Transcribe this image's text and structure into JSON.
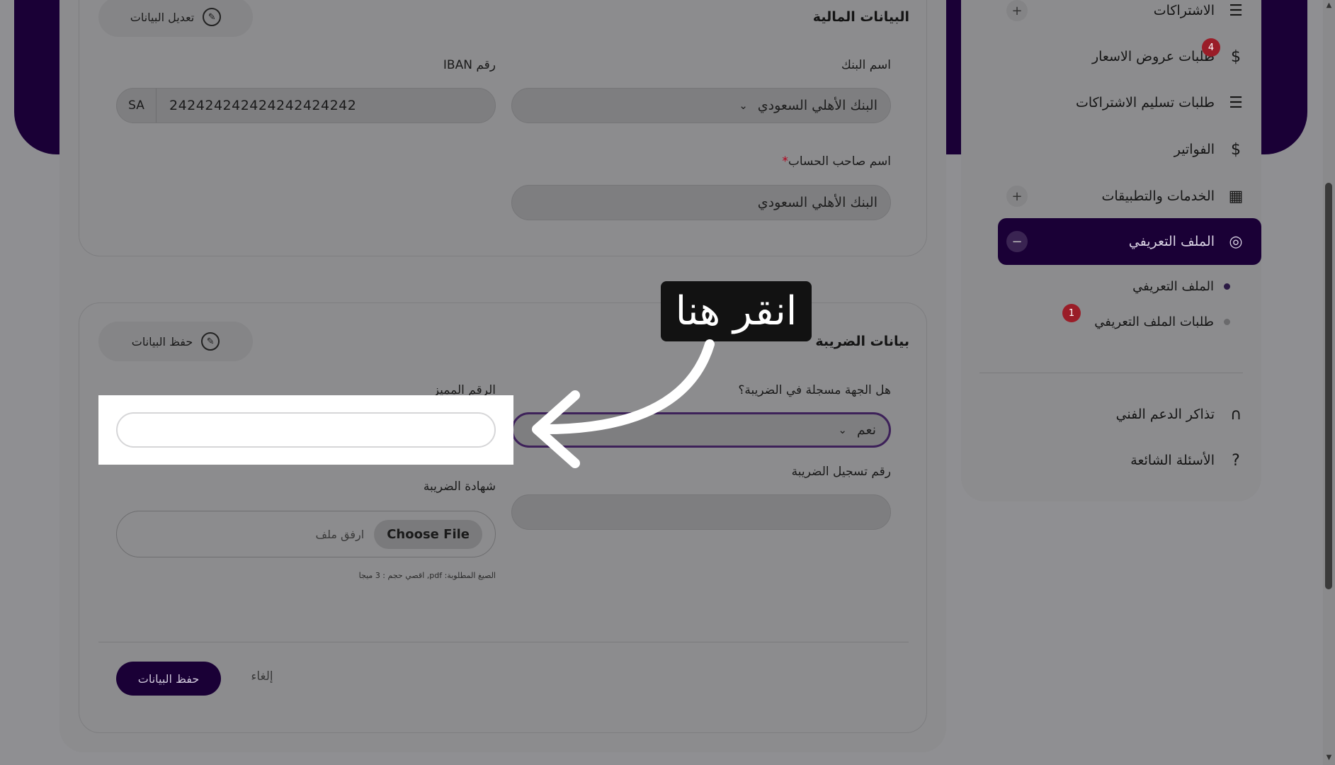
{
  "financial": {
    "title": "البيانات المالية",
    "edit_button": "تعديل البيانات",
    "bank_label": "اسم البنك",
    "bank_value": "البنك الأهلي السعودي",
    "iban_label": "رقم IBAN",
    "iban_prefix": "SA",
    "iban_value": "242424242424242424242",
    "holder_label": "اسم صاحب الحساب",
    "holder_required": "*",
    "holder_value": "البنك الأهلي السعودي"
  },
  "tax": {
    "title": "بيانات الضريبة",
    "save_button": "حفظ البيانات",
    "registered_label": "هل الجهة مسجلة في الضريبة؟",
    "registered_value": "نعم",
    "unique_label": "الرقم المميز",
    "unique_value": "",
    "reg_number_label": "رقم تسجيل الضريبة",
    "reg_number_value": "",
    "certificate_label": "شهادة الضريبة",
    "choose_file": "Choose File",
    "file_hint": "ارفق ملف",
    "formats_hint": "الصيغ المطلوبة: pdf, اقصي حجم : 3 ميجا"
  },
  "footer": {
    "save_label": "حفظ البيانات",
    "cancel_label": "إلغاء"
  },
  "tooltip": {
    "text": "انقر هنا"
  },
  "sidebar": {
    "items": [
      {
        "label": "الاشتراكات",
        "icon": "☰"
      },
      {
        "label": "طلبات عروض الاسعار",
        "icon": "$",
        "badge": "4"
      },
      {
        "label": "طلبات تسليم الاشتراكات",
        "icon": "☰"
      },
      {
        "label": "الفواتير",
        "icon": "$"
      },
      {
        "label": "الخدمات والتطبيقات",
        "icon": "▦"
      },
      {
        "label": "الملف التعريفي",
        "icon": "◎"
      },
      {
        "label": "تذاكر الدعم الفني",
        "icon": "∩"
      },
      {
        "label": "الأسئلة الشائعة",
        "icon": "?"
      }
    ],
    "sub_items": [
      {
        "label": "الملف التعريفي"
      },
      {
        "label": "طلبات الملف التعريفي",
        "badge": "1"
      }
    ],
    "plus": "+",
    "minus": "−"
  },
  "colors": {
    "brand": "#1a0036",
    "badge": "#9a1d28"
  }
}
